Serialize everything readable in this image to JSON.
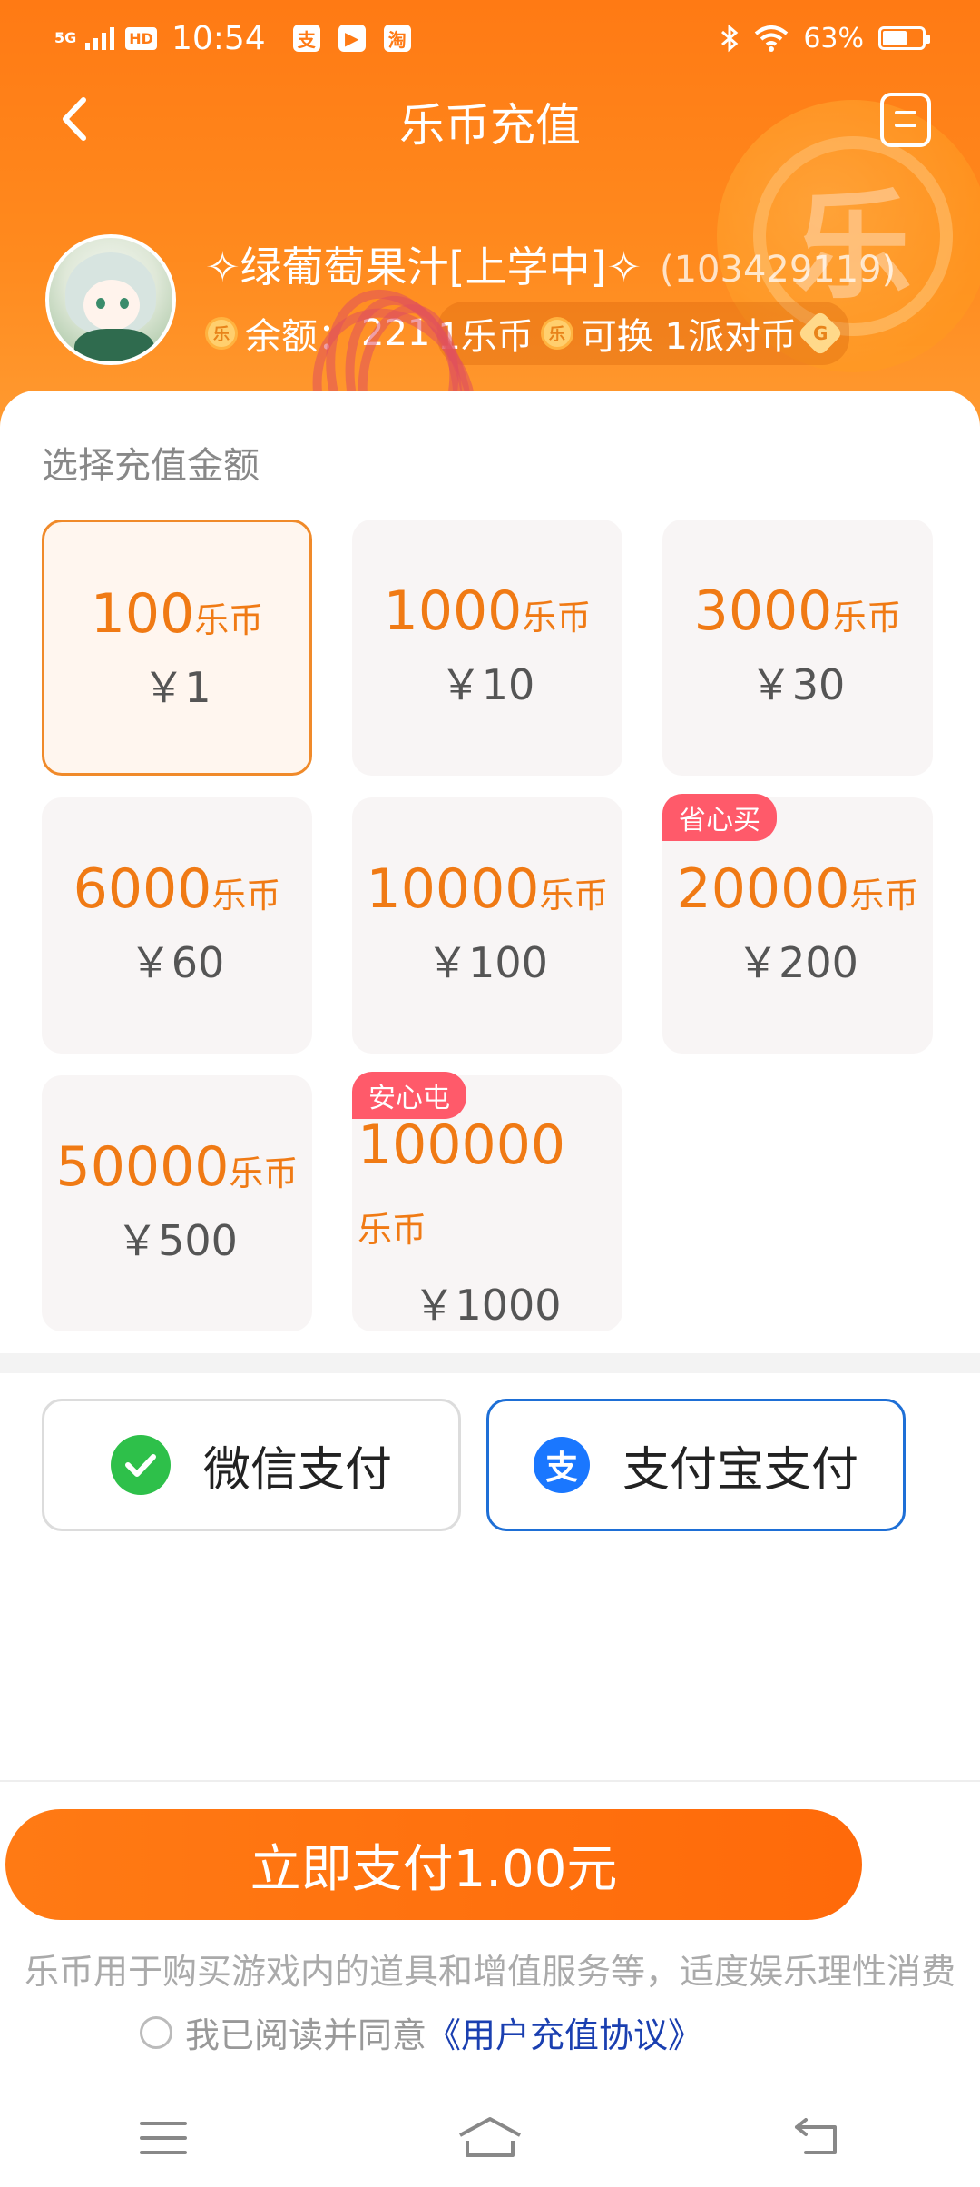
{
  "status_bar": {
    "network": "5G",
    "hd": "HD",
    "time": "10:54",
    "apps": [
      "支",
      "▶",
      "淘"
    ],
    "battery": "63%"
  },
  "nav": {
    "title": "乐币充值"
  },
  "profile": {
    "nickname": "✧绿葡萄果汁[上学中]✧",
    "uid": "(103429119)",
    "balance_label": "余额：",
    "balance_value": "221",
    "rate_left": "1乐币",
    "rate_mid": "可换 1派对币",
    "coin_char": "乐",
    "party_char": "G"
  },
  "section": {
    "title": "选择充值金额"
  },
  "packages": [
    {
      "amount": "100",
      "unit": "乐币",
      "price": "￥1",
      "tag": ""
    },
    {
      "amount": "1000",
      "unit": "乐币",
      "price": "￥10",
      "tag": ""
    },
    {
      "amount": "3000",
      "unit": "乐币",
      "price": "￥30",
      "tag": ""
    },
    {
      "amount": "6000",
      "unit": "乐币",
      "price": "￥60",
      "tag": ""
    },
    {
      "amount": "10000",
      "unit": "乐币",
      "price": "￥100",
      "tag": ""
    },
    {
      "amount": "20000",
      "unit": "乐币",
      "price": "￥200",
      "tag": "省心买"
    },
    {
      "amount": "50000",
      "unit": "乐币",
      "price": "￥500",
      "tag": ""
    },
    {
      "amount": "100000",
      "unit": "乐币",
      "price": "￥1000",
      "tag": "安心屯"
    }
  ],
  "selected_package_index": 0,
  "payment": {
    "wechat_label": "微信支付",
    "alipay_label": "支付宝支付",
    "alipay_icon": "支",
    "selected": "alipay"
  },
  "footer": {
    "pay_button": "立即支付1.00元",
    "notice": "乐币用于购买游戏内的道具和增值服务等，适度娱乐理性消费",
    "agree_text": "我已阅读并同意",
    "agreement_link": "《用户充值协议》"
  },
  "colors": {
    "accent": "#ff7a14",
    "alipay": "#1a77ff",
    "wechat": "#2ec04a",
    "tag": "#ff5a6a",
    "link": "#1a3fb0"
  }
}
